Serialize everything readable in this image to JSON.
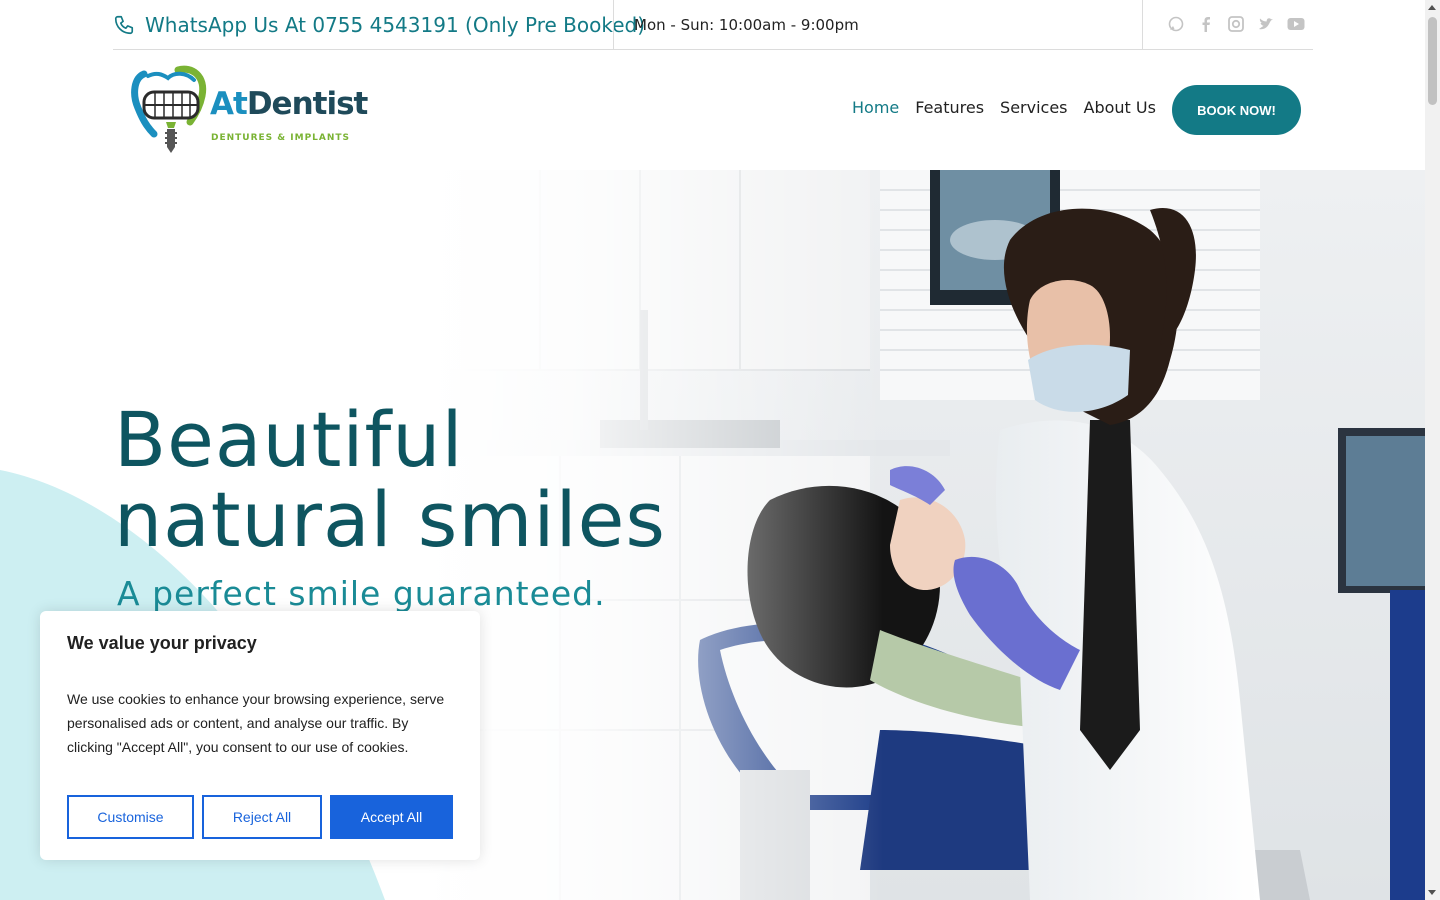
{
  "topbar": {
    "phone_text": "WhatsApp Us At 0755 4543191 (Only Pre Booked)",
    "hours_text": "Mon - Sun: 10:00am - 9:00pm",
    "social": [
      "whatsapp-icon",
      "facebook-icon",
      "instagram-icon",
      "twitter-icon",
      "youtube-icon"
    ]
  },
  "logo": {
    "brand_prefix": "At",
    "brand_name": "Dentist",
    "tagline": "DENTURES & IMPLANTS"
  },
  "nav": {
    "items": [
      {
        "label": "Home",
        "active": true
      },
      {
        "label": "Features",
        "active": false
      },
      {
        "label": "Services",
        "active": false
      },
      {
        "label": "About Us",
        "active": false
      }
    ],
    "cta_label": "BOOK NOW!"
  },
  "hero": {
    "title_line1": "Beautiful",
    "title_line2": "natural smiles",
    "subtitle": "A perfect smile guaranteed."
  },
  "cookie": {
    "title": "We value your privacy",
    "text": "We use cookies to enhance your browsing experience, serve personalised ads or content, and analyse our traffic. By clicking \"Accept All\", you consent to our use of cookies.",
    "customise_label": "Customise",
    "reject_label": "Reject All",
    "accept_label": "Accept All"
  },
  "colors": {
    "brand_teal": "#137a86",
    "hero_title": "#0e5560",
    "hero_subtitle": "#1a8b96",
    "cookie_blue": "#1863dc",
    "decor_cyan": "#cdeff2"
  }
}
